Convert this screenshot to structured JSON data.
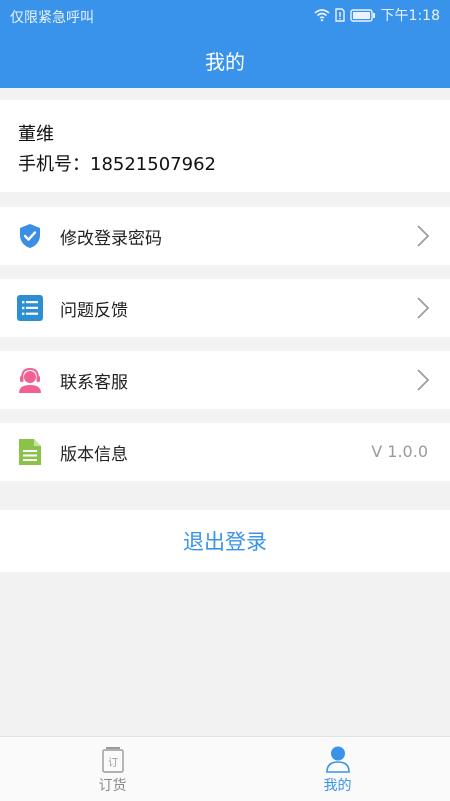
{
  "status_bar": {
    "carrier": "仅限紧急呼叫",
    "time": "下午1:18",
    "icons": [
      "wifi-icon",
      "sim-icon",
      "battery-icon"
    ]
  },
  "header": {
    "title": "我的"
  },
  "profile": {
    "name": "董维",
    "phone": "手机号：18521507962"
  },
  "menu": [
    {
      "label": "修改登录密码",
      "icon": "shield-check-icon",
      "icon_color": "#3a8ee6"
    },
    {
      "label": "问题反馈",
      "icon": "list-icon",
      "icon_color": "#2c8fd4"
    },
    {
      "label": "联系客服",
      "icon": "customer-service-icon",
      "icon_color": "#f06292"
    },
    {
      "label": "版本信息",
      "icon": "document-icon",
      "icon_color": "#8bc34a",
      "value": "V 1.0.0"
    }
  ],
  "logout": {
    "label": "退出登录"
  },
  "tabbar": {
    "tabs": [
      {
        "label": "订货",
        "icon": "order-icon",
        "icon_glyph": "订",
        "active": false
      },
      {
        "label": "我的",
        "icon": "profile-icon",
        "active": true
      }
    ]
  },
  "colors": {
    "primary": "#3a93ea",
    "background": "#f2f2f2",
    "inactive_tab": "#8a8a8a"
  }
}
